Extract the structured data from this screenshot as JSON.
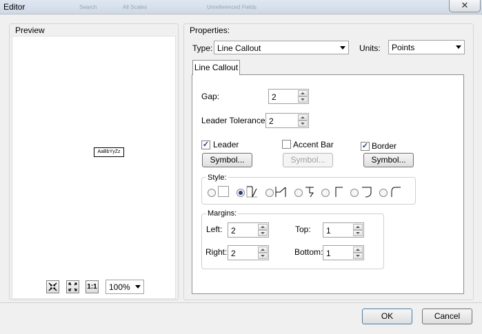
{
  "window": {
    "title": "Editor",
    "close_label": "✕"
  },
  "preview": {
    "label": "Preview",
    "sample_text": "AaBbYyZz",
    "zoom_value": "100%",
    "actual_size_label": "1:1"
  },
  "properties": {
    "label": "Properties:",
    "type_label": "Type:",
    "type_value": "Line Callout",
    "units_label": "Units:",
    "units_value": "Points",
    "tab_label": "Line Callout",
    "gap_label": "Gap:",
    "gap_value": "2",
    "leader_tolerance_label": "Leader Tolerance:",
    "leader_tolerance_value": "2",
    "leader_label": "Leader",
    "leader_checked": true,
    "accent_bar_label": "Accent Bar",
    "accent_bar_checked": false,
    "border_label": "Border",
    "border_checked": true,
    "symbol_label": "Symbol...",
    "style_label": "Style:",
    "margins": {
      "label": "Margins:",
      "left_label": "Left:",
      "left_value": "2",
      "top_label": "Top:",
      "top_value": "1",
      "right_label": "Right:",
      "right_value": "2",
      "bottom_label": "Bottom:",
      "bottom_value": "1"
    }
  },
  "buttons": {
    "ok": "OK",
    "cancel": "Cancel"
  },
  "ghost_text": [
    "Search",
    "All Scales",
    "Unreferenced Fields"
  ]
}
